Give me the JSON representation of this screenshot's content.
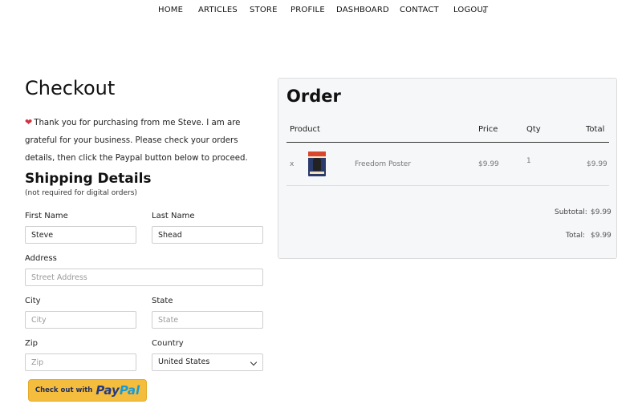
{
  "nav": {
    "items": [
      "HOME",
      "ARTICLES",
      "STORE",
      "PROFILE",
      "DASHBOARD",
      "CONTACT",
      "LOGOUT"
    ]
  },
  "checkout": {
    "title": "Checkout",
    "intro": "Thank you for purchasing from me Steve. I am are grateful for your business. Please check your orders details, then click the Paypal button below to proceed."
  },
  "shipping": {
    "title": "Shipping Details",
    "subtitle": "(not required for digital orders)",
    "first_name": {
      "label": "First Name",
      "value": "Steve"
    },
    "last_name": {
      "label": "Last Name",
      "value": "Shead"
    },
    "address": {
      "label": "Address",
      "placeholder": "Street Address"
    },
    "city": {
      "label": "City",
      "placeholder": "City"
    },
    "state": {
      "label": "State",
      "placeholder": "State"
    },
    "zip": {
      "label": "Zip",
      "placeholder": "Zip"
    },
    "country": {
      "label": "Country",
      "value": "United States"
    }
  },
  "paypal": {
    "prefix": "Check out with",
    "logo_pay": "Pay",
    "logo_pal": "Pal"
  },
  "order": {
    "title": "Order",
    "columns": {
      "product": "Product",
      "price": "Price",
      "qty": "Qty",
      "total": "Total"
    },
    "items": [
      {
        "remove": "x",
        "name": "Freedom Poster",
        "price": "$9.99",
        "qty": "1",
        "total": "$9.99"
      }
    ],
    "subtotal_label": "Subtotal:",
    "subtotal": "$9.99",
    "total_label": "Total:",
    "total": "$9.99"
  },
  "colors": {
    "heart": "#d4313f",
    "paypal_button": "#f5bd3d",
    "paypal_pay": "#253b80",
    "paypal_pal": "#179bd7",
    "panel_bg": "#f6f7f9"
  },
  "icons": {
    "intro": "heart-icon",
    "country_select": "chevron-down-icon"
  }
}
